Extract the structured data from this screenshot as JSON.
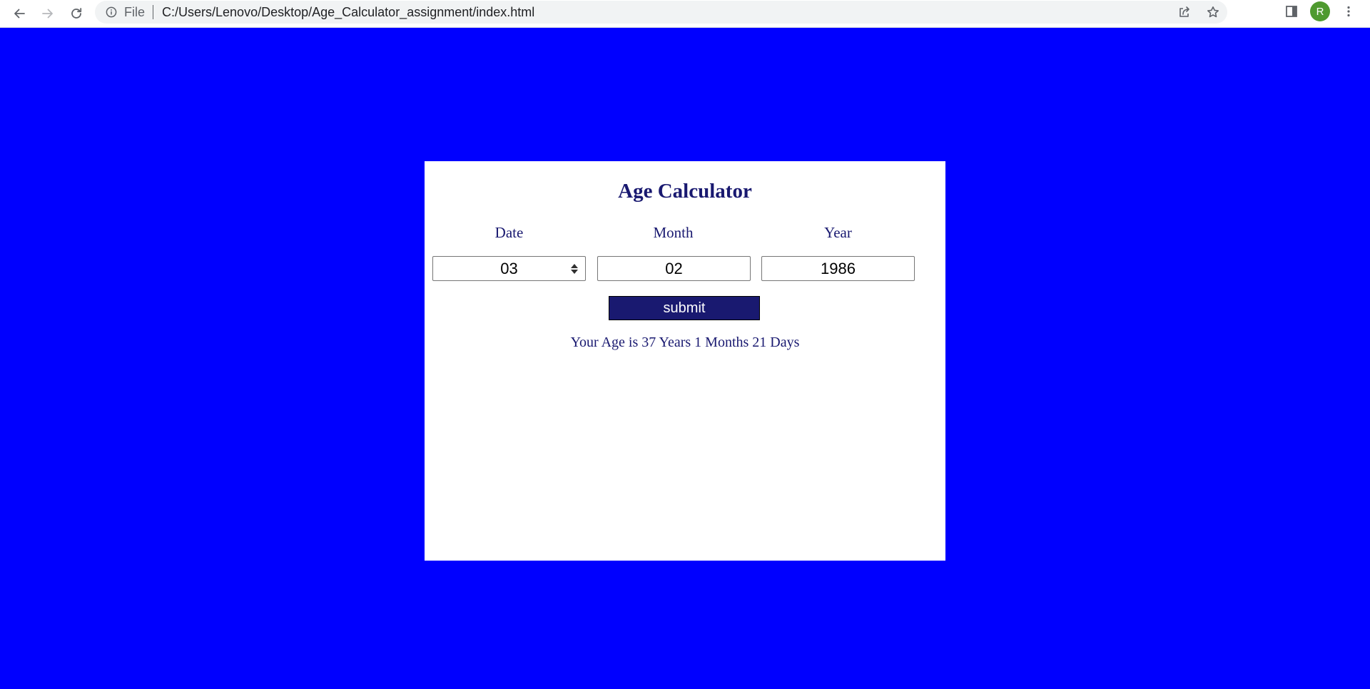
{
  "browser": {
    "site_info_label": "File",
    "url": "C:/Users/Lenovo/Desktop/Age_Calculator_assignment/index.html",
    "profile_initial": "R",
    "icons": {
      "back": "back-arrow-icon",
      "forward": "forward-arrow-icon",
      "reload": "reload-icon",
      "site_info": "info-icon",
      "share": "share-icon",
      "bookmark": "star-icon",
      "side_panel": "side-panel-icon",
      "menu": "kebab-menu-icon"
    }
  },
  "page": {
    "title": "Age Calculator",
    "labels": {
      "date": "Date",
      "month": "Month",
      "year": "Year"
    },
    "inputs": {
      "date": "03",
      "month": "02",
      "year": "1986"
    },
    "submit_label": "submit",
    "result": "Your Age is 37 Years 1 Months 21 Days"
  },
  "colors": {
    "page_background": "#0000ff",
    "card_background": "#ffffff",
    "accent": "#191970",
    "button_text": "#ffffff",
    "avatar": "#4f9a2f"
  }
}
